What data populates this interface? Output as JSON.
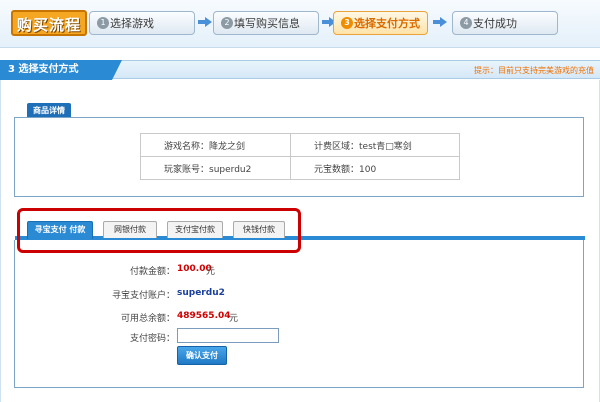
{
  "header": {
    "brand": "购买流程",
    "steps": [
      {
        "num": "1",
        "label": "选择游戏",
        "active": false
      },
      {
        "num": "2",
        "label": "填写购买信息",
        "active": false
      },
      {
        "num": "3",
        "label": "选择支付方式",
        "active": true
      },
      {
        "num": "4",
        "label": "支付成功",
        "active": false
      }
    ]
  },
  "section": {
    "title": "3 选择支付方式",
    "tip": "提示：目前只支持完美游戏的充值"
  },
  "details": {
    "legend": "商品详情",
    "game_label": "游戏名称：",
    "game_value": "降龙之剑",
    "region_label": "计费区域：",
    "region_value": "test青□寒剑",
    "account_label": "玩家账号：",
    "account_value": "superdu2",
    "ingot_label": "元宝数额：",
    "ingot_value": "100"
  },
  "payment": {
    "tabs": [
      "寻宝支付 付款",
      "网银付款",
      "支付宝付款",
      "快钱付款"
    ],
    "amount_label": "付款金额：",
    "amount_value": "100.00",
    "amount_unit": "元",
    "account_label": "寻宝支付账户：",
    "account_value": "superdu2",
    "balance_label": "可用总余额：",
    "balance_value": "489565.04",
    "balance_unit": "元",
    "password_label": "支付密码：",
    "password_value": "",
    "confirm_label": "确认支付"
  },
  "colors": {
    "accent": "#2b8ad4",
    "highlight": "#cc0000",
    "money": "#d00000"
  }
}
